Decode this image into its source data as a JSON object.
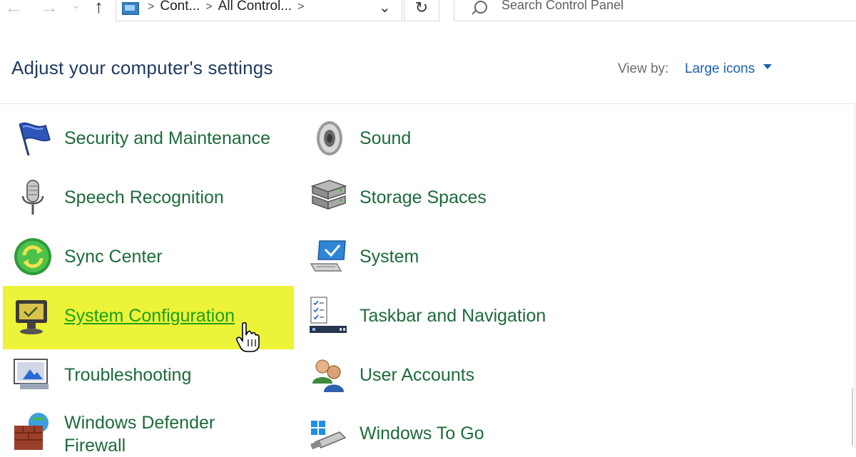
{
  "toolbar": {
    "back_icon": "arrow-left-icon",
    "forward_icon": "arrow-right-icon",
    "up_icon": "arrow-up-icon",
    "refresh_icon": "refresh-icon",
    "breadcrumb": [
      "Cont...",
      "All Control..."
    ],
    "search_placeholder": "Search Control Panel"
  },
  "header": {
    "title": "Adjust your computer's settings",
    "view_by_label": "View by:",
    "view_by_value": "Large icons"
  },
  "items": [
    {
      "label": "Security and Maintenance",
      "icon": "flag-icon"
    },
    {
      "label": "Sound",
      "icon": "speaker-icon"
    },
    {
      "label": "Speech Recognition",
      "icon": "microphone-icon"
    },
    {
      "label": "Storage Spaces",
      "icon": "storage-icon"
    },
    {
      "label": "Sync Center",
      "icon": "sync-icon"
    },
    {
      "label": "System",
      "icon": "computer-icon"
    },
    {
      "label": "System Configuration",
      "icon": "monitor-config-icon",
      "highlighted": true
    },
    {
      "label": "Taskbar and Navigation",
      "icon": "taskbar-icon"
    },
    {
      "label": "Troubleshooting",
      "icon": "troubleshoot-icon"
    },
    {
      "label": "User Accounts",
      "icon": "users-icon"
    },
    {
      "label": "Windows Defender Firewall",
      "icon": "firewall-icon"
    },
    {
      "label": "Windows To Go",
      "icon": "usb-windows-icon"
    }
  ],
  "colors": {
    "link": "#1c6b3a",
    "link_hover": "#1aa01a",
    "title": "#1e3a5f",
    "highlight": "#ecf338",
    "dropdown": "#1a5fb4"
  }
}
